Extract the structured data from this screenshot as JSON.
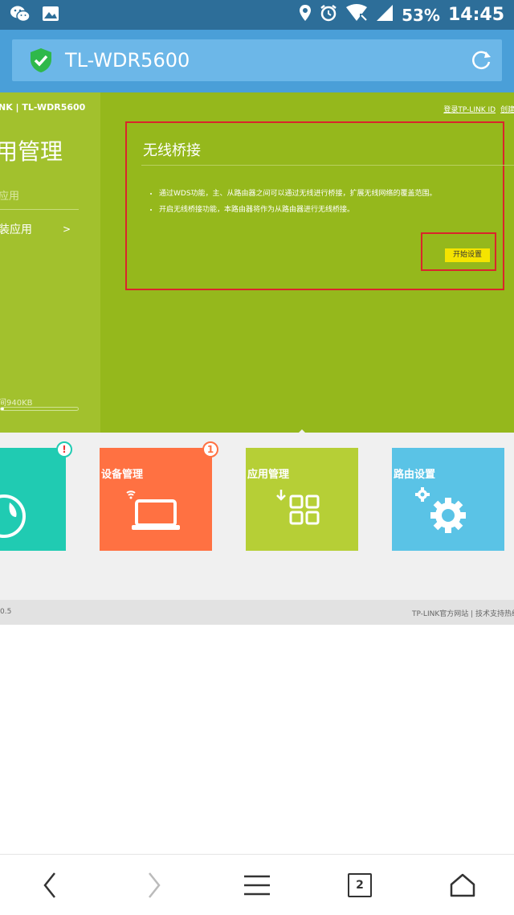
{
  "status_bar": {
    "battery": "53%",
    "time": "14:45",
    "icons": [
      "wechat-icon",
      "image-icon",
      "location-icon",
      "alarm-icon",
      "wifi-icon",
      "signal-icon"
    ]
  },
  "address_bar": {
    "title": "TL-WDR5600",
    "icons": [
      "shield-check-icon",
      "refresh-icon"
    ]
  },
  "sidebar": {
    "brand": "NK | TL-WDR5600",
    "title": "用管理",
    "link1": "应用",
    "link2": "装应用",
    "link2_arrow": ">",
    "memory_text": "间940KB",
    "memory_fraction": 0.04
  },
  "header_links": {
    "login": "登录TP-LINK ID",
    "create": "创建TP"
  },
  "panel": {
    "title": "无线桥接",
    "bullets": [
      "通过WDS功能，主、从路由器之间可以通过无线进行桥接，扩展无线网络的覆盖范围。",
      "开启无线桥接功能，本路由器将作为从路由器进行无线桥接。"
    ],
    "button": "开始设置"
  },
  "tiles": [
    {
      "label": "",
      "badge": "!",
      "color": "#20cbb2",
      "icon": "globe-icon"
    },
    {
      "label": "设备管理",
      "badge": "1",
      "color": "#ff7142",
      "icon": "laptop-wifi-icon"
    },
    {
      "label": "应用管理",
      "badge": "",
      "color": "#b6cf36",
      "icon": "apps-grid-icon"
    },
    {
      "label": "路由设置",
      "badge": "",
      "color": "#5ac3e6",
      "icon": "gear-icon"
    }
  ],
  "footer": {
    "left": "0.5",
    "right": "TP-LINK官方网站  |  技术支持热线"
  },
  "bottom_nav": {
    "tab_count": "2",
    "icons": [
      "back-icon",
      "forward-icon",
      "menu-icon",
      "tabs-icon",
      "home-icon"
    ]
  }
}
